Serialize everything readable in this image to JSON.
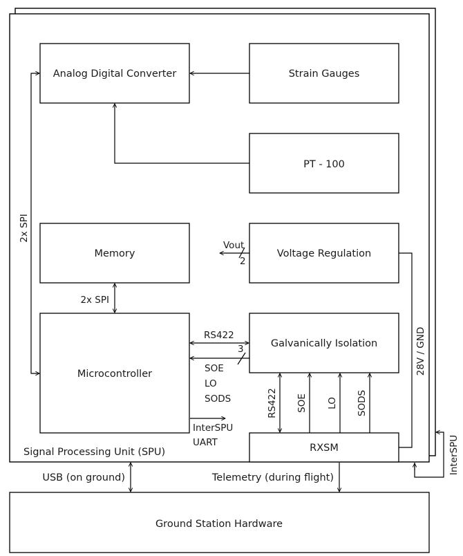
{
  "diagram": {
    "blocks": {
      "adc": "Analog Digital Converter",
      "strain_gauges": "Strain Gauges",
      "pt100": "PT - 100",
      "memory": "Memory",
      "voltage_regulation": "Voltage Regulation",
      "microcontroller": "Microcontroller",
      "galvanic_isolation": "Galvanically Isolation",
      "rxsm": "RXSM",
      "ground_station": "Ground Station Hardware"
    },
    "container_label": "Signal Processing Unit (SPU)",
    "labels": {
      "spi_left": "2x SPI",
      "spi_memory": "2x SPI",
      "vout": "Vout",
      "vout_bus_width": "2",
      "rs422_mc": "RS422",
      "bus3_width": "3",
      "soe": "SOE",
      "lo": "LO",
      "sods": "SODS",
      "interspu_uart_1": "InterSPU",
      "interspu_uart_2": "UART",
      "rs422_vertical": "RS422",
      "soe_vertical": "SOE",
      "lo_vertical": "LO",
      "sods_vertical": "SODS",
      "power": "28V / GND",
      "interspu_right": "InterSPU",
      "usb": "USB (on ground)",
      "telemetry": "Telemetry (during flight)"
    }
  }
}
